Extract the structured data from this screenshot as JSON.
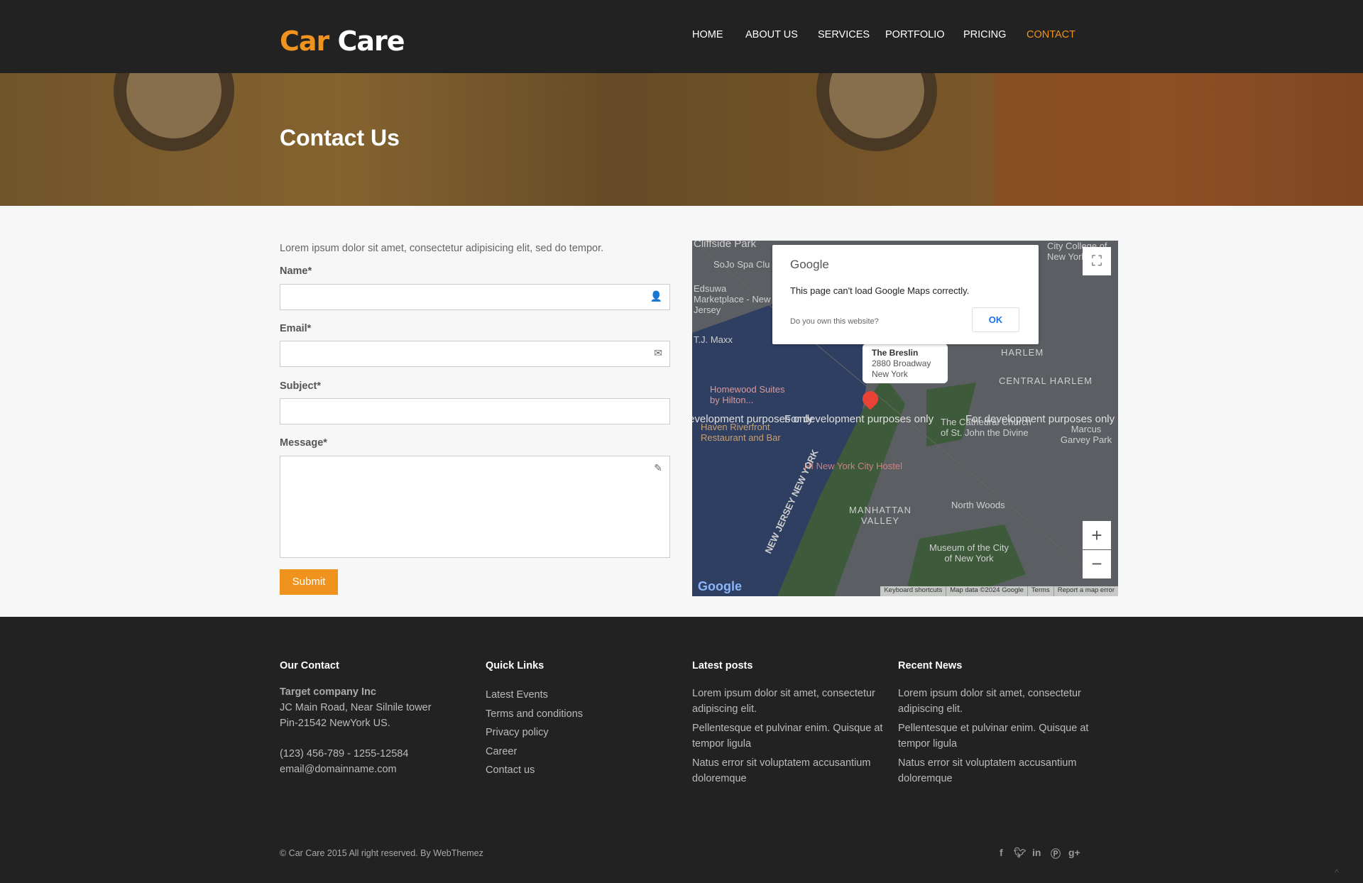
{
  "brand": {
    "part1": "Car",
    "part2": "Care"
  },
  "nav": [
    "HOME",
    "ABOUT US",
    "SERVICES",
    "PORTFOLIO",
    "PRICING",
    "CONTACT"
  ],
  "nav_active": "CONTACT",
  "accent": "#f0931e",
  "banner": {
    "title": "Contact Us"
  },
  "form": {
    "intro": "Lorem ipsum dolor sit amet, consectetur adipisicing elit, sed do tempor.",
    "name_label": "Name*",
    "email_label": "Email*",
    "subject_label": "Subject*",
    "message_label": "Message*",
    "submit": "Submit",
    "name": "",
    "email": "",
    "subject": "",
    "message": ""
  },
  "map": {
    "dialog_brand": "Google",
    "dialog_message": "This page can't load Google Maps correctly.",
    "dialog_question": "Do you own this website?",
    "ok": "OK",
    "info_title": "The Breslin",
    "info_line1": "2880 Broadway",
    "info_line2": "New York",
    "labels": [
      "Cliffside Park",
      "SoJo Spa Clu",
      "Edsuwa Marketplace - New Jersey",
      "T.J. Maxx",
      "Homewood Suites by Hilton...",
      "Haven Riverfront Restaurant and Bar",
      "HARLEM",
      "CENTRAL HARLEM",
      "The Cathedral Church of St. John the Divine",
      "Marcus Garvey Park",
      "HI New York City Hostel",
      "MANHATTAN VALLEY",
      "North Woods",
      "Museum of the City of New York",
      "NEW JERSEY NEW YORK",
      "City College of New York"
    ],
    "watermark": "For development purposes only",
    "footer_links": [
      "Keyboard shortcuts",
      "Map data ©2024 Google",
      "Terms",
      "Report a map error"
    ],
    "logo": "Google"
  },
  "footer": {
    "contact": {
      "heading": "Our Contact",
      "company": "Target company Inc",
      "address1": "JC Main Road, Near Silnile tower",
      "address2": "Pin-21542 NewYork US.",
      "phone": "(123) 456-789 - 1255-12584",
      "email": "email@domainname.com"
    },
    "quick": {
      "heading": "Quick Links",
      "links": [
        "Latest Events",
        "Terms and conditions",
        "Privacy policy",
        "Career",
        "Contact us"
      ]
    },
    "posts": {
      "heading": "Latest posts",
      "items": [
        "Lorem ipsum dolor sit amet, consectetur adipiscing elit.",
        "Pellentesque et pulvinar enim. Quisque at tempor ligula",
        "Natus error sit voluptatem accusantium doloremque"
      ]
    },
    "news": {
      "heading": "Recent News",
      "items": [
        "Lorem ipsum dolor sit amet, consectetur adipiscing elit.",
        "Pellentesque et pulvinar enim. Quisque at tempor ligula",
        "Natus error sit voluptatem accusantium doloremque"
      ]
    },
    "copyright": "© Car Care 2015 All right reserved. By WebThemez",
    "social": [
      "facebook",
      "twitter",
      "linkedin",
      "pinterest",
      "google-plus"
    ]
  }
}
